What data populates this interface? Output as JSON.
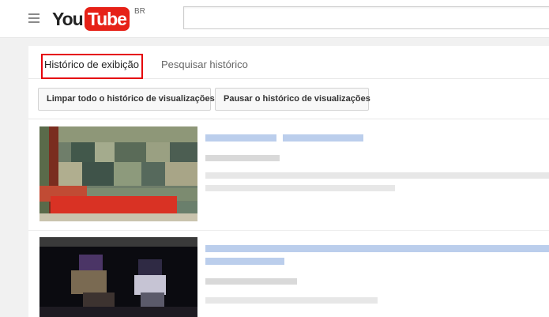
{
  "masthead": {
    "logo_you": "You",
    "logo_tube": "Tube",
    "region": "BR",
    "search_value": ""
  },
  "tabs": [
    {
      "label": "Histórico de exibição",
      "active": true
    },
    {
      "label": "Pesquisar histórico",
      "active": false
    }
  ],
  "actions": {
    "clear_label": "Limpar todo o histórico de visualizações",
    "pause_label": "Pausar o histórico de visualizações"
  },
  "colors": {
    "brand_red": "#e62117",
    "highlight": "#e5000b",
    "link_blur": "#b4c9ea"
  }
}
